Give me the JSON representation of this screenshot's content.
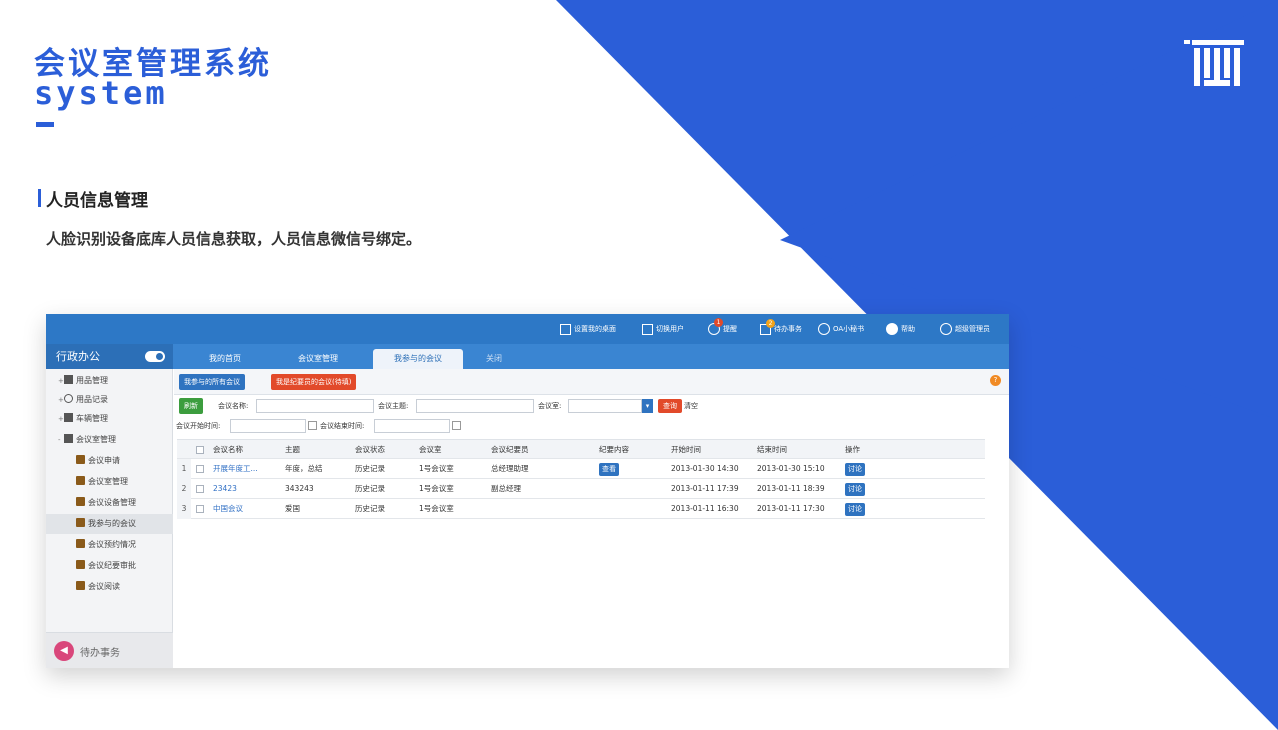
{
  "slide": {
    "title_cn": "会议室管理系统",
    "title_en": "system",
    "section_title": "人员信息管理",
    "description": "人脸识别设备底库人员信息获取，人员信息微信号绑定。",
    "brand_color": "#2b5ed8",
    "logo_icon": "brand-logo-icon"
  },
  "app": {
    "topbar": {
      "items": [
        {
          "label": "设置我的桌面",
          "icon": "desktop-grid-icon"
        },
        {
          "label": "切换用户",
          "icon": "switch-user-icon"
        },
        {
          "label": "提醒",
          "icon": "reminder-icon",
          "badge": "1"
        },
        {
          "label": "待办事务",
          "icon": "todo-icon",
          "badge": "2"
        },
        {
          "label": "OA小秘书",
          "icon": "clock-icon"
        },
        {
          "label": "帮助",
          "icon": "help-icon"
        },
        {
          "label": "超级管理员",
          "icon": "user-icon"
        }
      ]
    },
    "sidebar": {
      "header": "行政办公",
      "items": [
        {
          "label": "用品管理",
          "icon": "grid-icon",
          "level": 0
        },
        {
          "label": "用品记录",
          "icon": "clock-icon",
          "level": 0
        },
        {
          "label": "车辆管理",
          "icon": "car-icon",
          "level": 0
        },
        {
          "label": "会议室管理",
          "icon": "building-icon",
          "level": 0
        },
        {
          "label": "会议申请",
          "icon": "briefcase-icon",
          "level": 1
        },
        {
          "label": "会议室管理",
          "icon": "briefcase-icon",
          "level": 1
        },
        {
          "label": "会议设备管理",
          "icon": "briefcase-icon",
          "level": 1
        },
        {
          "label": "我参与的会议",
          "icon": "briefcase-icon",
          "level": 1,
          "active": true
        },
        {
          "label": "会议预约情况",
          "icon": "briefcase-icon",
          "level": 1
        },
        {
          "label": "会议纪要审批",
          "icon": "briefcase-icon",
          "level": 1
        },
        {
          "label": "会议阅读",
          "icon": "briefcase-icon",
          "level": 1
        }
      ],
      "todo_label": "待办事务"
    },
    "tabs": [
      {
        "label": "我的首页"
      },
      {
        "label": "会议室管理"
      },
      {
        "label": "我参与的会议",
        "active": true
      },
      {
        "label": "关闭"
      }
    ],
    "toolbar": {
      "btn_all_meetings": "我参与的所有会议",
      "btn_minutes_pending": "我是纪要员的会议(待填)"
    },
    "filter": {
      "refresh": "刷新",
      "meeting_name_label": "会议名称:",
      "meeting_name_value": "",
      "subject_label": "会议主题:",
      "subject_value": "",
      "room_label": "会议室:",
      "room_value": "",
      "query": "查询",
      "clear": "清空",
      "start_label": "会议开始时间:",
      "end_label": "会议结束时间:"
    },
    "table": {
      "columns": [
        "会议名称",
        "主题",
        "会议状态",
        "会议室",
        "会议纪要员",
        "纪要内容",
        "开始时间",
        "结束时间",
        "操作"
      ],
      "rows": [
        {
          "num": "1",
          "name": "开展年度工...",
          "subject": "年度，总结",
          "status": "历史记录",
          "room": "1号会议室",
          "recorder": "总经理助理",
          "minutes": "查看",
          "start": "2013-01-30 14:30",
          "end": "2013-01-30 15:10",
          "action": "讨论"
        },
        {
          "num": "2",
          "name": "23423",
          "subject": "343243",
          "status": "历史记录",
          "room": "1号会议室",
          "recorder": "副总经理",
          "minutes": "",
          "start": "2013-01-11 17:39",
          "end": "2013-01-11 18:39",
          "action": "讨论"
        },
        {
          "num": "3",
          "name": "中国会议",
          "subject": "爱国",
          "status": "历史记录",
          "room": "1号会议室",
          "recorder": "",
          "minutes": "",
          "start": "2013-01-11 16:30",
          "end": "2013-01-11 17:30",
          "action": "讨论"
        }
      ]
    }
  }
}
